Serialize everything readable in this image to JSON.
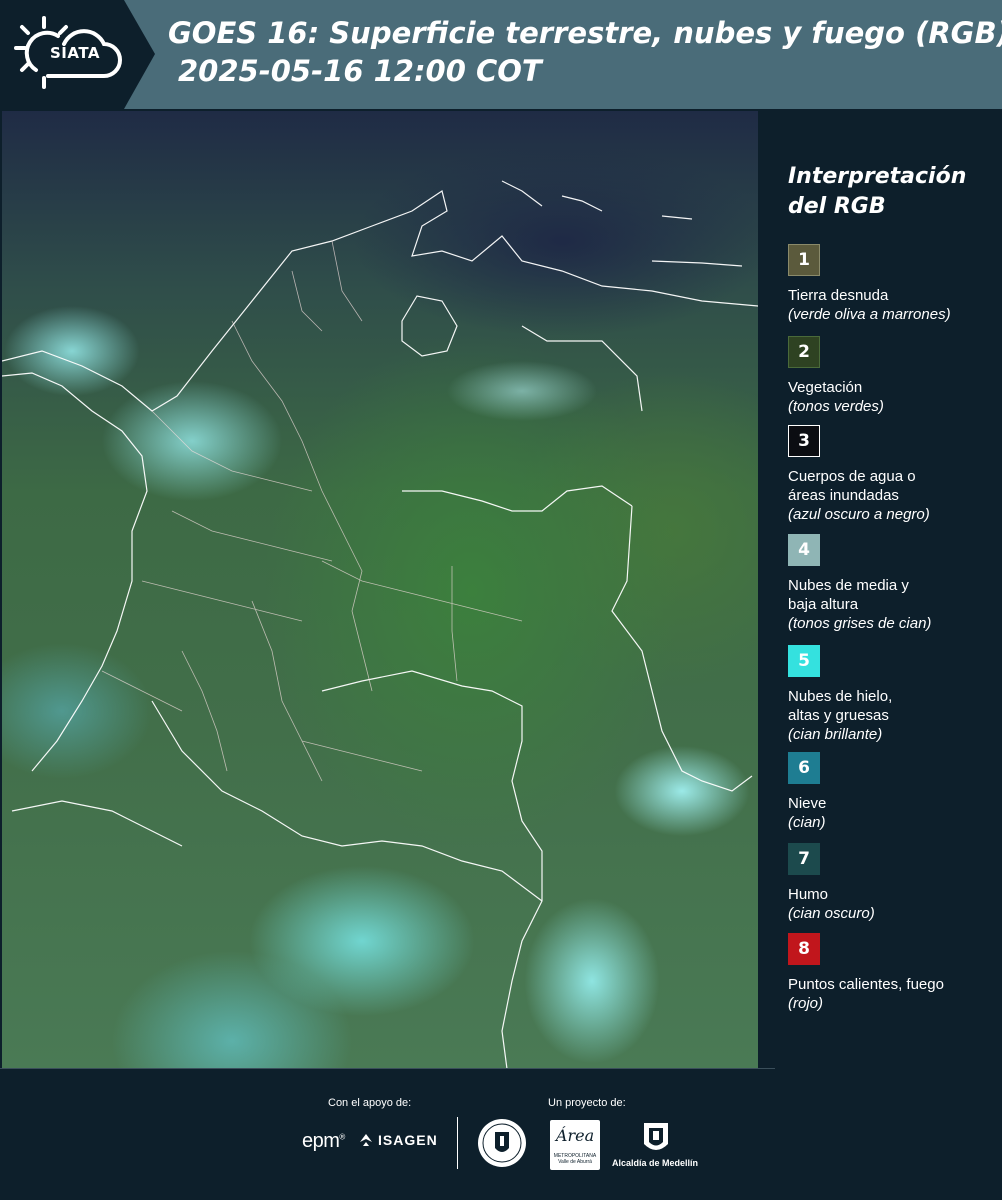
{
  "header": {
    "logo_text": "SIATA",
    "title_line1": "GOES 16: Superficie terrestre, nubes y fuego (RGB)",
    "title_line2": "2025-05-16 12:00 COT"
  },
  "legend": {
    "title": "Interpretación del RGB",
    "items": [
      {
        "number": "1",
        "label": "Tierra desnuda",
        "hint": "(verde oliva a marrones)",
        "color": "#5b5a3c"
      },
      {
        "number": "2",
        "label": "Vegetación",
        "hint": "(tonos verdes)",
        "color": "#2e4222"
      },
      {
        "number": "3",
        "label": "Cuerpos de agua o\náreas inundadas",
        "hint": "(azul oscuro a negro)",
        "color": "#0b0d12"
      },
      {
        "number": "4",
        "label": "Nubes de media y\nbaja altura",
        "hint": "(tonos grises de cian)",
        "color": "#8fb5b5"
      },
      {
        "number": "5",
        "label": "Nubes de hielo,\naltas y gruesas",
        "hint": "(cian brillante)",
        "color": "#34e1df"
      },
      {
        "number": "6",
        "label": "Nieve",
        "hint": "(cian)",
        "color": "#1e7d92"
      },
      {
        "number": "7",
        "label": "Humo",
        "hint": "(cian oscuro)",
        "color": "#1c4a4d"
      },
      {
        "number": "8",
        "label": "Puntos calientes, fuego",
        "hint": "(rojo)",
        "color": "#c1161c"
      }
    ]
  },
  "footer": {
    "support_label": "Con el apoyo de:",
    "project_label": "Un proyecto de:",
    "epm_logo": "epm",
    "isagen_logo": "ISAGEN",
    "amva_logo": "Área",
    "amva_sub": "METROPOLITANA\nValle de Aburrá",
    "alcaldia_logo": "Alcaldía de Medellín"
  },
  "colors": {
    "header_bg": "#4a6c79",
    "page_bg": "#0d1f2b",
    "border_lines": "#ffffff"
  }
}
